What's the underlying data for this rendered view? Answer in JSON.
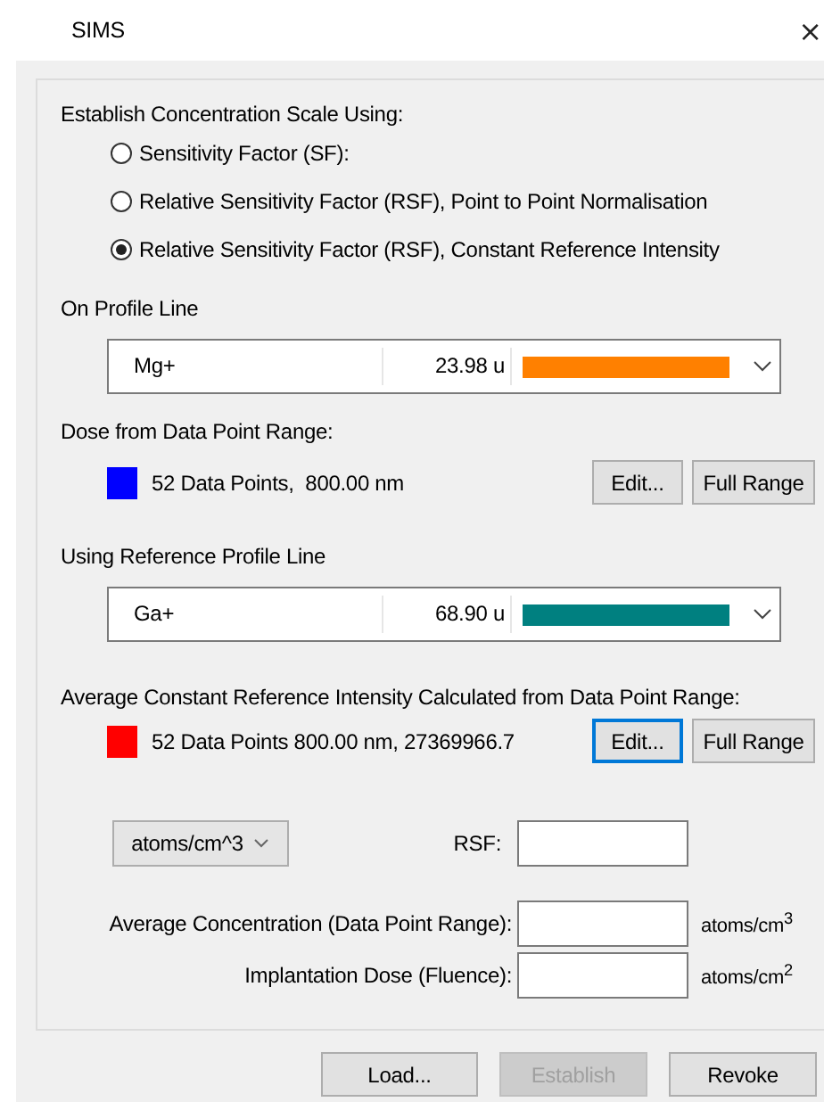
{
  "window": {
    "title": "SIMS",
    "close": "×"
  },
  "scale": {
    "label": "Establish Concentration Scale Using:",
    "options": [
      {
        "label": "Sensitivity Factor (SF):",
        "selected": false
      },
      {
        "label": "Relative Sensitivity Factor (RSF), Point to Point Normalisation",
        "selected": false
      },
      {
        "label": "Relative Sensitivity Factor (RSF), Constant Reference Intensity",
        "selected": true
      }
    ]
  },
  "sections": [
    {
      "label": "On Profile Line",
      "combo": {
        "name": "Mg+",
        "mass": "23.98 u",
        "color": "#ff8000"
      },
      "range_label": "Dose from Data Point Range:",
      "range": {
        "color": "#0000ff",
        "text": "52 Data Points,  800.00 nm",
        "buttons": [
          {
            "label": "Edit...",
            "focused": false
          },
          {
            "label": "Full Range",
            "focused": false
          }
        ]
      }
    },
    {
      "label": "Using Reference Profile Line",
      "combo": {
        "name": "Ga+",
        "mass": "68.90 u",
        "color": "#008080"
      },
      "range_label": "Average Constant Reference Intensity Calculated from Data Point Range:",
      "range": {
        "color": "#ff0000",
        "text": "52 Data Points 800.00 nm, 27369966.7",
        "buttons": [
          {
            "label": "Edit...",
            "focused": true
          },
          {
            "label": "Full Range",
            "focused": false
          }
        ]
      }
    }
  ],
  "unit_dropdown": {
    "value": "atoms/cm^3"
  },
  "rsf": {
    "label": "RSF:"
  },
  "fields": [
    {
      "label": "Average Concentration (Data Point Range):",
      "unit": "atoms/cm$^{3}$"
    },
    {
      "label": "Implantation Dose (Fluence):",
      "unit": "atoms/cm$^{2}$"
    }
  ],
  "buttons": [
    {
      "label": "Load...",
      "disabled": false
    },
    {
      "label": "Establish",
      "disabled": true
    },
    {
      "label": "Revoke",
      "disabled": false
    }
  ]
}
